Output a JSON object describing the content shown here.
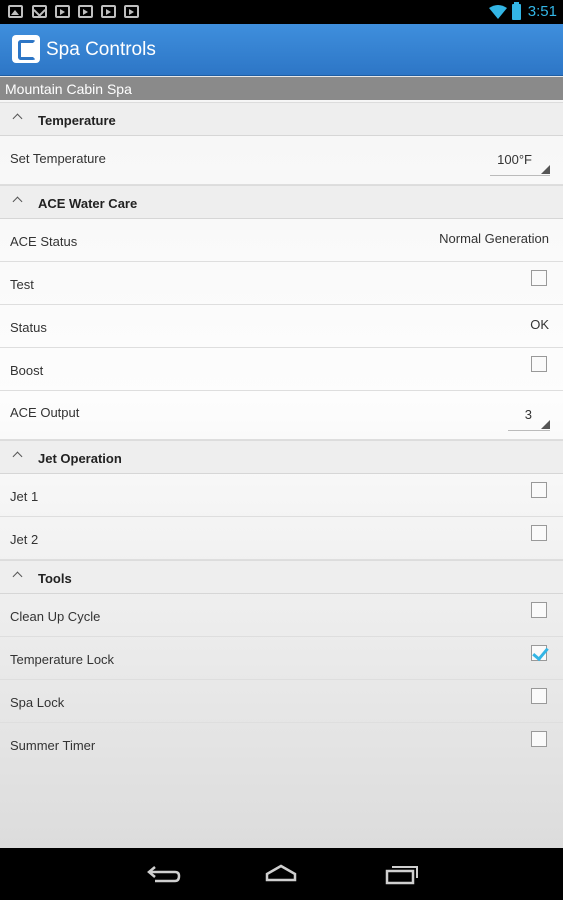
{
  "status_bar": {
    "time": "3:51"
  },
  "action_bar": {
    "title": "Spa Controls"
  },
  "spa_name": "Mountain Cabin Spa",
  "sections": {
    "temperature": {
      "title": "Temperature",
      "set_temperature_label": "Set Temperature",
      "set_temperature_value": "100°F"
    },
    "ace": {
      "title": "ACE Water Care",
      "ace_status_label": "ACE Status",
      "ace_status_value": "Normal Generation",
      "test_label": "Test",
      "test_checked": false,
      "status_label": "Status",
      "status_value": "OK",
      "boost_label": "Boost",
      "boost_checked": false,
      "ace_output_label": "ACE Output",
      "ace_output_value": "3"
    },
    "jets": {
      "title": "Jet Operation",
      "jet1_label": "Jet 1",
      "jet1_checked": false,
      "jet2_label": "Jet 2",
      "jet2_checked": false
    },
    "tools": {
      "title": "Tools",
      "clean_up_label": "Clean Up Cycle",
      "clean_up_checked": false,
      "temp_lock_label": "Temperature Lock",
      "temp_lock_checked": true,
      "spa_lock_label": "Spa Lock",
      "spa_lock_checked": false,
      "summer_timer_label": "Summer Timer",
      "summer_timer_checked": false
    }
  },
  "colors": {
    "accent": "#33b5e5",
    "action_bar": "#2d76c6"
  }
}
